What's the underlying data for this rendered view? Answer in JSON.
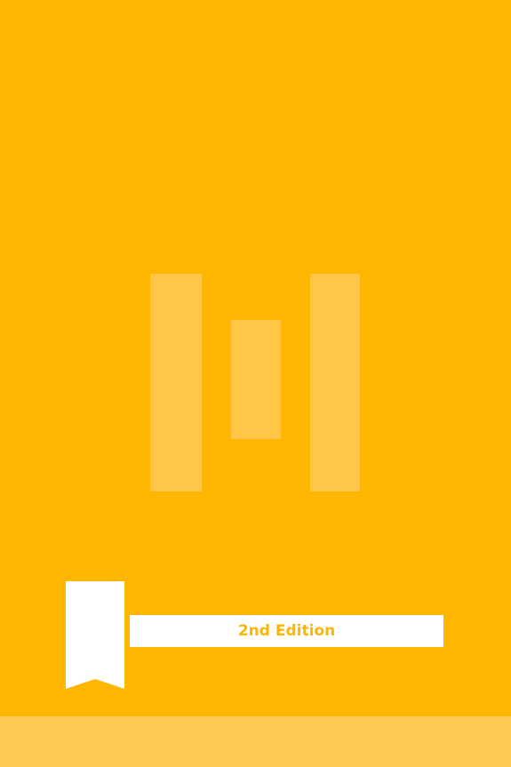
{
  "cover": {
    "edition_label": "2nd Edition",
    "logo_icon": "three-bars-logo-icon",
    "ribbon_icon": "bookmark-ribbon-icon"
  },
  "colors": {
    "background": "#FFB600",
    "logo_bars": "#FFC64A",
    "footer_band": "#FFC851",
    "ribbon": "#FFFFFF",
    "edition_text": "#FFB600"
  }
}
